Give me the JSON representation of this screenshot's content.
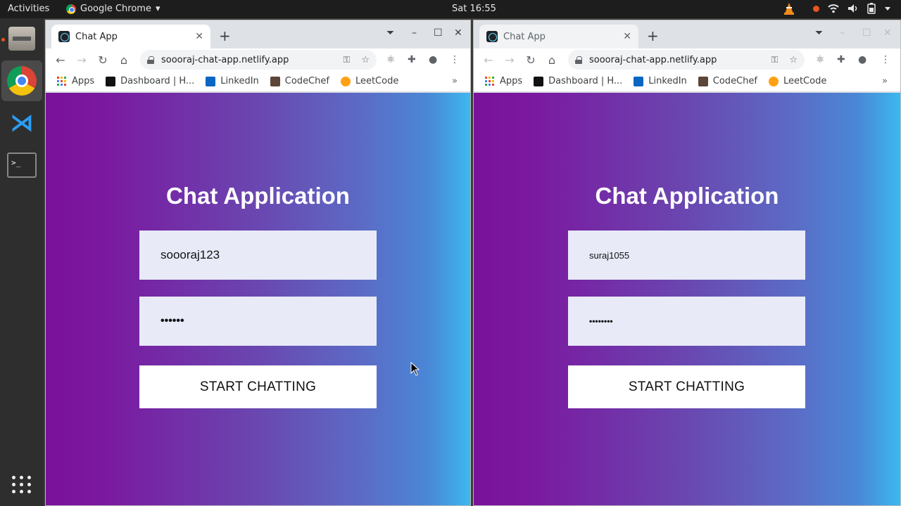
{
  "topbar": {
    "activities": "Activities",
    "app_name": "Google Chrome",
    "app_menu_arrow": "▾",
    "clock": "Sat 16:55"
  },
  "colors": {
    "gradient_start": "#7a119b",
    "gradient_end": "#3cb8ee",
    "field_bg": "#e8eaf8",
    "button_bg": "#ffffff"
  },
  "windows": [
    {
      "tab_title": "Chat App",
      "url": "soooraj-chat-app.netlify.app",
      "bookmarks": [
        "Apps",
        "Dashboard | H...",
        "LinkedIn",
        "CodeChef",
        "LeetCode"
      ],
      "page": {
        "heading": "Chat Application",
        "username_value": "soooraj123",
        "password_value": "••••••",
        "submit_label": "START CHATTING"
      }
    },
    {
      "tab_title": "Chat App",
      "url": "soooraj-chat-app.netlify.app",
      "bookmarks": [
        "Apps",
        "Dashboard | H...",
        "LinkedIn",
        "CodeChef",
        "LeetCode"
      ],
      "page": {
        "heading": "Chat Application",
        "username_value": "suraj1055",
        "password_value": "••••••••",
        "submit_label": "START CHATTING"
      }
    }
  ],
  "icons": {
    "tab_close": "✕",
    "new_tab": "+",
    "back": "←",
    "forward": "→",
    "reload": "↻",
    "home": "⌂",
    "key": "⚿",
    "star": "☆",
    "more": "⋮",
    "bookmarks_more": "»",
    "minimize": "–",
    "maximize": "☐",
    "close": "✕"
  }
}
